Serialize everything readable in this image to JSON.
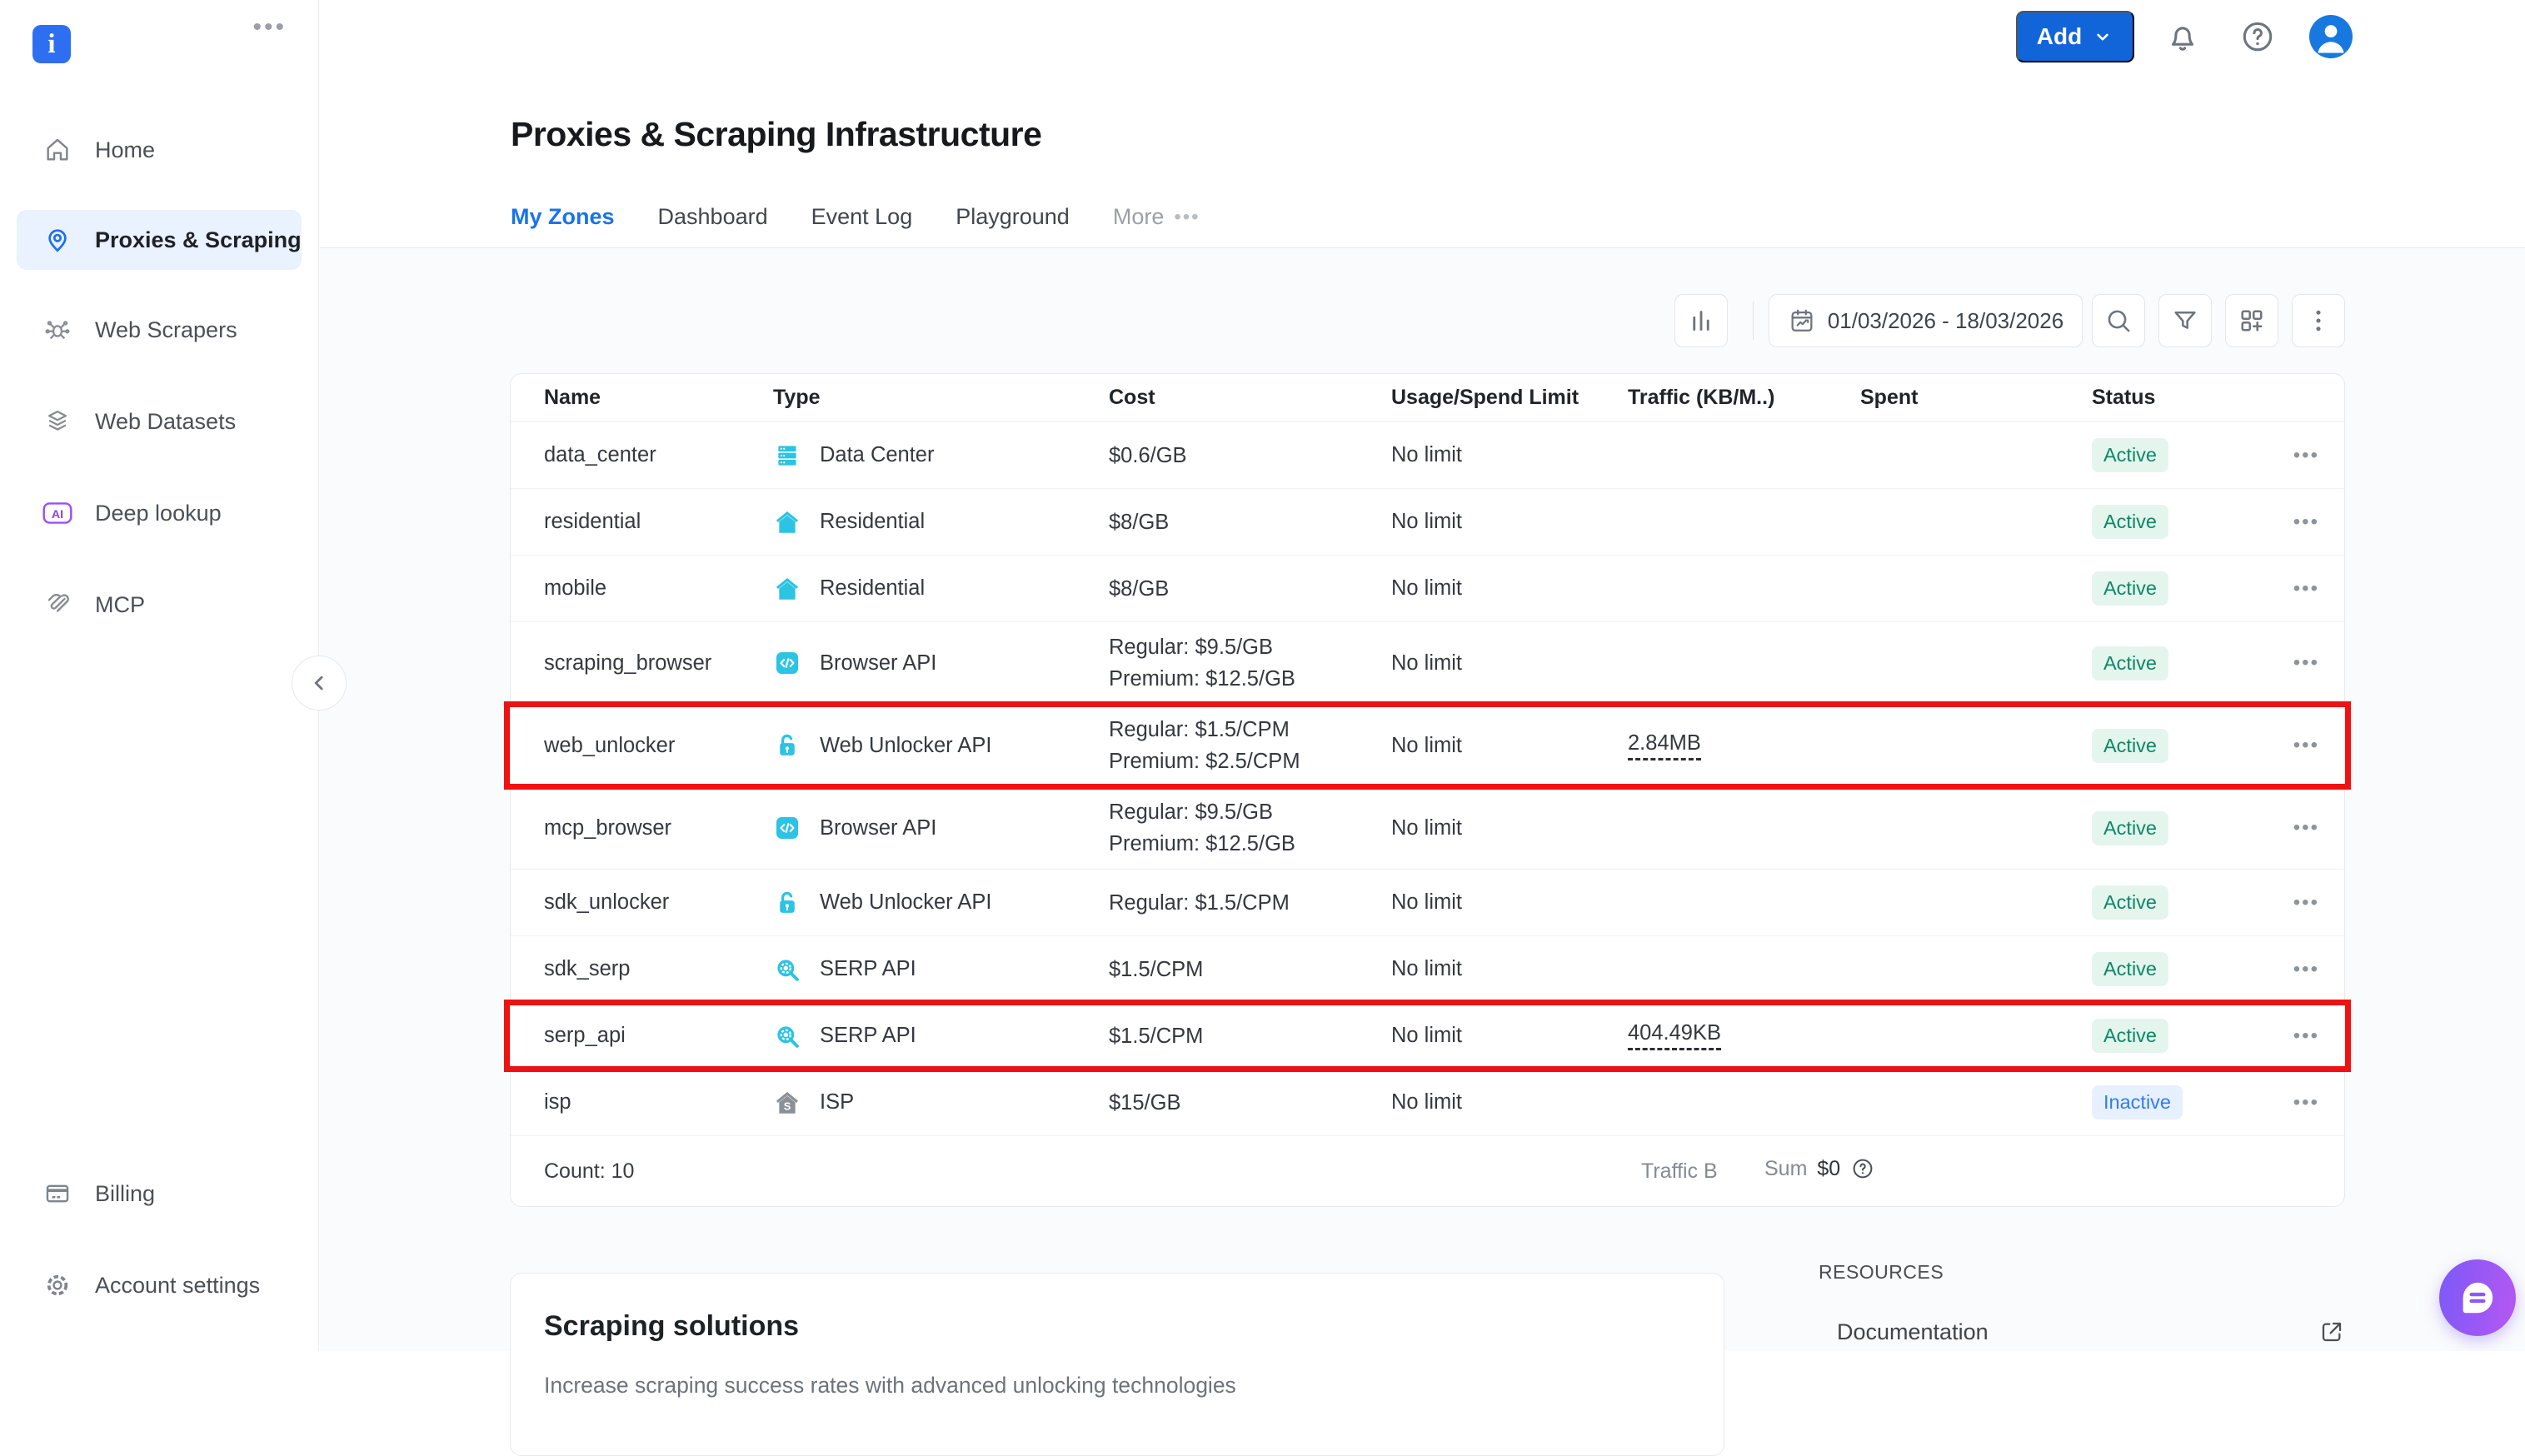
{
  "brand": {
    "logo_letter": "i"
  },
  "colors": {
    "accent_blue": "#1a73e8",
    "add_button_blue": "#1165d8",
    "avatar_blue": "#1779e0",
    "zone_icon_cyan": "#2cc3e4",
    "sidebar_active_bg": "#e9f2fe",
    "active_badge_bg": "#e4f5ee",
    "active_badge_text": "#0c8766",
    "inactive_badge_bg": "#e7f0fe",
    "inactive_badge_text": "#2f7cf6",
    "highlight_red": "#ee1212",
    "chat_gradient_start": "#7a5af8",
    "chat_gradient_end": "#b757f2"
  },
  "icons": {
    "sidebar-menu-dots": "horizontal ellipsis",
    "home-icon": "house outline",
    "location-pin-icon": "map pin",
    "spider-icon": "web crawler spider",
    "layers-icon": "stacked dataset layers",
    "ai-badge-icon": "AI in rounded box",
    "mcp-icon": "paperclip swirl",
    "billing-icon": "credit card",
    "gear-icon": "settings gear",
    "bell-icon": "notification bell",
    "help-icon": "question mark circle",
    "avatar-icon": "person silhouette",
    "column-chart-icon": "vertical bars",
    "calendar-icon": "calendar with trend arrow",
    "search-icon": "magnifier",
    "filter-icon": "funnel",
    "grid-add-icon": "grid with plus",
    "kebab-icon": "vertical dots",
    "server-icon": "data center stack",
    "house-icon": "residential house",
    "code-window-icon": "browser api </>",
    "unlock-icon": "open padlock",
    "serp-icon": "magnifier with gear",
    "isp-house-icon": "grey house with S",
    "external-link-icon": "box with arrow",
    "chat-icon": "speech bubble"
  },
  "sidebar": {
    "items": [
      {
        "label": "Home",
        "icon": "home",
        "active": false
      },
      {
        "label": "Proxies & Scraping",
        "icon": "pin",
        "active": true
      },
      {
        "label": "Web Scrapers",
        "icon": "spider",
        "active": false
      },
      {
        "label": "Web Datasets",
        "icon": "layers",
        "active": false
      },
      {
        "label": "Deep lookup",
        "icon": "ai",
        "active": false
      },
      {
        "label": "MCP",
        "icon": "mcp",
        "active": false
      }
    ],
    "bottom_items": [
      {
        "label": "Billing",
        "icon": "billing",
        "active": false
      },
      {
        "label": "Account settings",
        "icon": "gear",
        "active": false
      }
    ]
  },
  "topbar": {
    "add_label": "Add"
  },
  "page": {
    "title": "Proxies & Scraping Infrastructure",
    "tabs": [
      {
        "label": "My Zones",
        "active": true,
        "muted": false,
        "dots": false
      },
      {
        "label": "Dashboard",
        "active": false,
        "muted": false,
        "dots": false
      },
      {
        "label": "Event Log",
        "active": false,
        "muted": false,
        "dots": false
      },
      {
        "label": "Playground",
        "active": false,
        "muted": false,
        "dots": false
      },
      {
        "label": "More",
        "active": false,
        "muted": true,
        "dots": true
      }
    ]
  },
  "toolbar": {
    "date_range": "01/03/2026 - 18/03/2026"
  },
  "table": {
    "columns": [
      "Name",
      "Type",
      "Cost",
      "Usage/Spend Limit",
      "Traffic (KB/M..)",
      "Spent",
      "Status"
    ],
    "rows": [
      {
        "name": "data_center",
        "type_label": "Data Center",
        "type_icon": "server",
        "cost_lines": [
          "$0.6/GB"
        ],
        "usage": "No limit",
        "traffic": "",
        "spent": "",
        "status": "Active",
        "highlighted": false
      },
      {
        "name": "residential",
        "type_label": "Residential",
        "type_icon": "house",
        "cost_lines": [
          "$8/GB"
        ],
        "usage": "No limit",
        "traffic": "",
        "spent": "",
        "status": "Active",
        "highlighted": false
      },
      {
        "name": "mobile",
        "type_label": "Residential",
        "type_icon": "house",
        "cost_lines": [
          "$8/GB"
        ],
        "usage": "No limit",
        "traffic": "",
        "spent": "",
        "status": "Active",
        "highlighted": false
      },
      {
        "name": "scraping_browser",
        "type_label": "Browser API",
        "type_icon": "code",
        "cost_lines": [
          "Regular: $9.5/GB",
          "Premium: $12.5/GB"
        ],
        "usage": "No limit",
        "traffic": "",
        "spent": "",
        "status": "Active",
        "highlighted": false
      },
      {
        "name": "web_unlocker",
        "type_label": "Web Unlocker API",
        "type_icon": "unlock",
        "cost_lines": [
          "Regular: $1.5/CPM",
          "Premium: $2.5/CPM"
        ],
        "usage": "No limit",
        "traffic": "2.84MB",
        "spent": "",
        "status": "Active",
        "highlighted": true
      },
      {
        "name": "mcp_browser",
        "type_label": "Browser API",
        "type_icon": "code",
        "cost_lines": [
          "Regular: $9.5/GB",
          "Premium: $12.5/GB"
        ],
        "usage": "No limit",
        "traffic": "",
        "spent": "",
        "status": "Active",
        "highlighted": false
      },
      {
        "name": "sdk_unlocker",
        "type_label": "Web Unlocker API",
        "type_icon": "unlock",
        "cost_lines": [
          "Regular: $1.5/CPM"
        ],
        "usage": "No limit",
        "traffic": "",
        "spent": "",
        "status": "Active",
        "highlighted": false
      },
      {
        "name": "sdk_serp",
        "type_label": "SERP API",
        "type_icon": "serp",
        "cost_lines": [
          "$1.5/CPM"
        ],
        "usage": "No limit",
        "traffic": "",
        "spent": "",
        "status": "Active",
        "highlighted": false
      },
      {
        "name": "serp_api",
        "type_label": "SERP API",
        "type_icon": "serp",
        "cost_lines": [
          "$1.5/CPM"
        ],
        "usage": "No limit",
        "traffic": "404.49KB",
        "spent": "",
        "status": "Active",
        "highlighted": true
      },
      {
        "name": "isp",
        "type_label": "ISP",
        "type_icon": "isp",
        "cost_lines": [
          "$15/GB"
        ],
        "usage": "No limit",
        "traffic": "",
        "spent": "",
        "status": "Inactive",
        "highlighted": false
      }
    ],
    "footer": {
      "count_label": "Count: 10",
      "traffic_label": "Traffic B",
      "sum_word": "Sum",
      "sum_value": "$0"
    }
  },
  "bottom": {
    "solutions_title": "Scraping solutions",
    "solutions_subtitle": "Increase scraping success rates with advanced unlocking technologies",
    "resources_title": "RESOURCES",
    "resources_links": [
      {
        "label": "Documentation"
      }
    ]
  }
}
